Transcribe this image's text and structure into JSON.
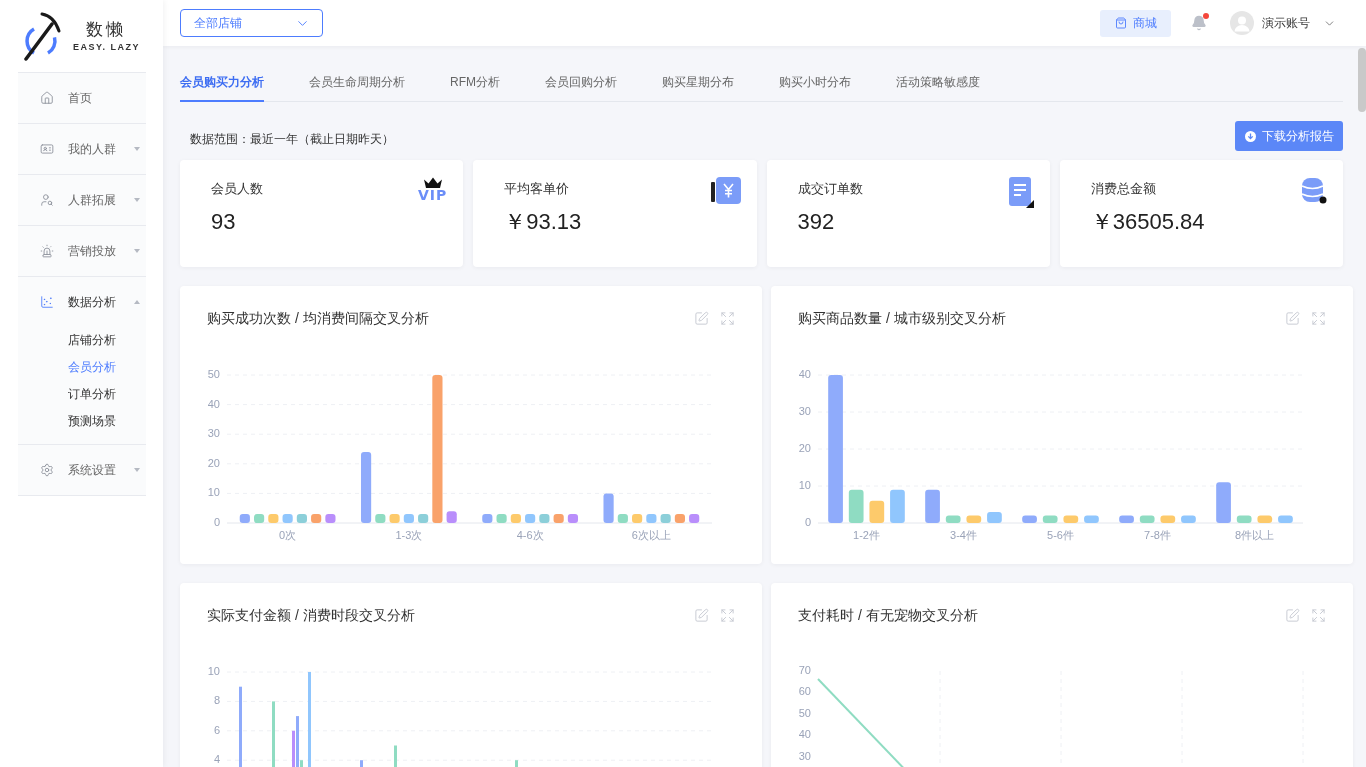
{
  "sidebar": {
    "logo": {
      "name": "数懒",
      "tagline": "EASY. LAZY"
    },
    "menu": [
      {
        "label": "首页"
      },
      {
        "label": "我的人群",
        "expanded": false
      },
      {
        "label": "人群拓展",
        "expanded": false
      },
      {
        "label": "营销投放",
        "expanded": false
      },
      {
        "label": "数据分析",
        "expanded": true,
        "children": [
          {
            "label": "店铺分析",
            "selected": false
          },
          {
            "label": "会员分析",
            "selected": true
          },
          {
            "label": "订单分析",
            "selected": false
          },
          {
            "label": "预测场景",
            "selected": false
          }
        ]
      },
      {
        "label": "系统设置",
        "expanded": false
      }
    ]
  },
  "topbar": {
    "store_select": {
      "value": "全部店铺"
    },
    "mall_button": "商城",
    "notifications": {
      "unread": true
    },
    "account": {
      "name": "演示账号"
    }
  },
  "tabs": [
    {
      "label": "会员购买力分析",
      "selected": true
    },
    {
      "label": "会员生命周期分析",
      "selected": false
    },
    {
      "label": "RFM分析",
      "selected": false
    },
    {
      "label": "会员回购分析",
      "selected": false
    },
    {
      "label": "购买星期分布",
      "selected": false
    },
    {
      "label": "购买小时分布",
      "selected": false
    },
    {
      "label": "活动策略敏感度",
      "selected": false
    }
  ],
  "data_range": "数据范围：最近一年（截止日期昨天）",
  "download_button": "下载分析报告",
  "stats": [
    {
      "label": "会员人数",
      "value": "93",
      "badge": "VIP"
    },
    {
      "label": "平均客单价",
      "value": "￥93.13"
    },
    {
      "label": "成交订单数",
      "value": "392"
    },
    {
      "label": "消费总金额",
      "value": "￥36505.84"
    }
  ],
  "charts": [
    {
      "title": "购买成功次数 / 均消费间隔交叉分析",
      "chart_data": {
        "type": "bar",
        "categories": [
          "0次",
          "1-3次",
          "4-6次",
          "6次以上"
        ],
        "ylim": [
          0,
          50
        ],
        "yticks": [
          0,
          10,
          20,
          30,
          40,
          50
        ],
        "grid": true,
        "series": [
          {
            "color": "#8fabfb",
            "values": [
              3,
              24,
              3,
              10
            ]
          },
          {
            "color": "#8fdcc2",
            "values": [
              3,
              3,
              3,
              3
            ]
          },
          {
            "color": "#fdca6b",
            "values": [
              3,
              3,
              3,
              3
            ]
          },
          {
            "color": "#90c6fd",
            "values": [
              3,
              3,
              3,
              3
            ]
          },
          {
            "color": "#8ccfd9",
            "values": [
              3,
              3,
              3,
              3
            ]
          },
          {
            "color": "#f9a26a",
            "values": [
              3,
              50,
              3,
              3
            ]
          },
          {
            "color": "#b98efb",
            "values": [
              3,
              4,
              3,
              3
            ]
          }
        ]
      }
    },
    {
      "title": "购买商品数量 / 城市级别交叉分析",
      "chart_data": {
        "type": "bar",
        "categories": [
          "1-2件",
          "3-4件",
          "5-6件",
          "7-8件",
          "8件以上"
        ],
        "ylim": [
          0,
          40
        ],
        "yticks": [
          0,
          10,
          20,
          30,
          40
        ],
        "grid": true,
        "series": [
          {
            "color": "#8fabfb",
            "values": [
              40,
              9,
              2,
              2,
              11
            ]
          },
          {
            "color": "#8fdcc2",
            "values": [
              9,
              2,
              2,
              2,
              2
            ]
          },
          {
            "color": "#fdca6b",
            "values": [
              6,
              2,
              2,
              2,
              2
            ]
          },
          {
            "color": "#90c6fd",
            "values": [
              9,
              3,
              2,
              2,
              2
            ]
          }
        ]
      }
    },
    {
      "title": "实际支付金额 / 消费时段交叉分析",
      "kind": "bar",
      "y_axis_labels": [
        "10",
        "8",
        "6",
        "4"
      ]
    },
    {
      "title": "支付耗时 / 有无宠物交叉分析",
      "kind": "line",
      "y_axis_labels": [
        "70",
        "60",
        "50",
        "40",
        "30"
      ]
    }
  ]
}
